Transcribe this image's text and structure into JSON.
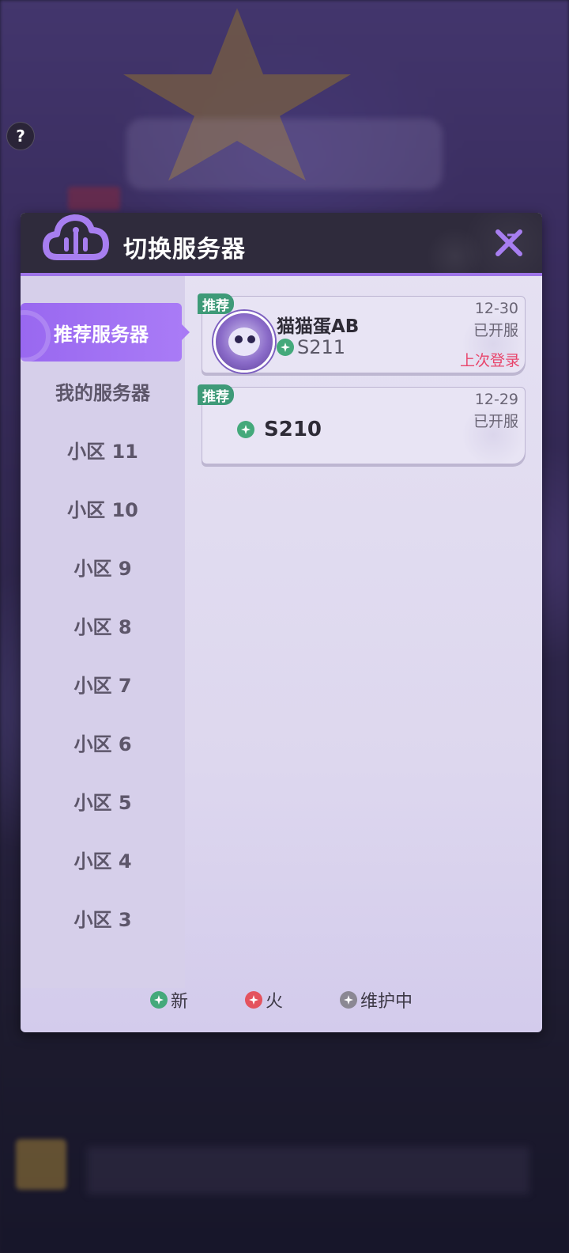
{
  "dialog": {
    "title": "切换服务器"
  },
  "sidebar": {
    "items": [
      {
        "label": "推荐服务器",
        "active": true
      },
      {
        "label": "我的服务器",
        "active": false
      },
      {
        "label": "小区 11",
        "active": false
      },
      {
        "label": "小区 10",
        "active": false
      },
      {
        "label": "小区 9",
        "active": false
      },
      {
        "label": "小区 8",
        "active": false
      },
      {
        "label": "小区 7",
        "active": false
      },
      {
        "label": "小区 6",
        "active": false
      },
      {
        "label": "小区 5",
        "active": false
      },
      {
        "label": "小区 4",
        "active": false
      },
      {
        "label": "小区 3",
        "active": false
      }
    ]
  },
  "servers": [
    {
      "tag": "推荐",
      "name": "猫猫蛋AB",
      "id": "S211",
      "date": "12-30",
      "status_text": "已开服",
      "last_login": "上次登录",
      "status": "new",
      "has_avatar": true
    },
    {
      "tag": "推荐",
      "id": "S210",
      "date": "12-29",
      "status_text": "已开服",
      "status": "new",
      "has_avatar": false
    }
  ],
  "legend": {
    "new": "新",
    "hot": "火",
    "maintenance": "维护中"
  },
  "colors": {
    "accent": "#9e74e8",
    "new": "#44a97b",
    "hot": "#e4535e",
    "maintenance": "#8b8893",
    "tag": "#3e9a78",
    "last_login": "#e8456b"
  }
}
